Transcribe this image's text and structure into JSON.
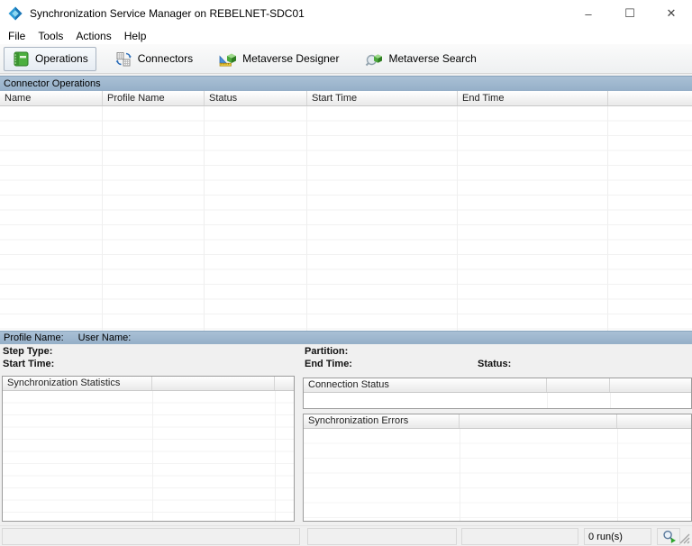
{
  "window": {
    "title": "Synchronization Service Manager on REBELNET-SDC01",
    "controls": {
      "minimize": "–",
      "maximize": "☐",
      "close": "✕"
    }
  },
  "menu": {
    "items": [
      "File",
      "Tools",
      "Actions",
      "Help"
    ]
  },
  "toolbar": {
    "buttons": [
      {
        "label": "Operations",
        "icon": "operations-book-icon",
        "active": true
      },
      {
        "label": "Connectors",
        "icon": "connectors-sync-icon",
        "active": false
      },
      {
        "label": "Metaverse Designer",
        "icon": "metaverse-designer-icon",
        "active": false
      },
      {
        "label": "Metaverse Search",
        "icon": "metaverse-search-icon",
        "active": false
      }
    ]
  },
  "connector_operations": {
    "section_title": "Connector Operations",
    "columns": [
      "Name",
      "Profile Name",
      "Status",
      "Start Time",
      "End Time"
    ],
    "rows": []
  },
  "detail": {
    "profile_name_label": "Profile Name:",
    "user_name_label": "User Name:",
    "step_type_label": "Step Type:",
    "start_time_label": "Start Time:",
    "partition_label": "Partition:",
    "end_time_label": "End Time:",
    "status_label": "Status:",
    "profile_name_value": "",
    "user_name_value": "",
    "step_type_value": "",
    "start_time_value": "",
    "partition_value": "",
    "end_time_value": "",
    "status_value": ""
  },
  "panels": {
    "sync_statistics": {
      "header": "Synchronization Statistics",
      "rows": []
    },
    "connection_status": {
      "header": "Connection Status",
      "rows": []
    },
    "sync_errors": {
      "header": "Synchronization Errors",
      "rows": []
    }
  },
  "status_bar": {
    "runs": "0 run(s)"
  },
  "icons": {
    "app": "sync-diamond-icon",
    "status_run": "magnifier-run-icon",
    "resize_grip": "diagonal-grip"
  },
  "colors": {
    "section_bar": "#9db7cf",
    "active_button_border": "#a9b4c1",
    "operations_green": "#4caf3f",
    "arrow_blue": "#2b6cb8",
    "run_icon_green": "#2ea52c"
  }
}
